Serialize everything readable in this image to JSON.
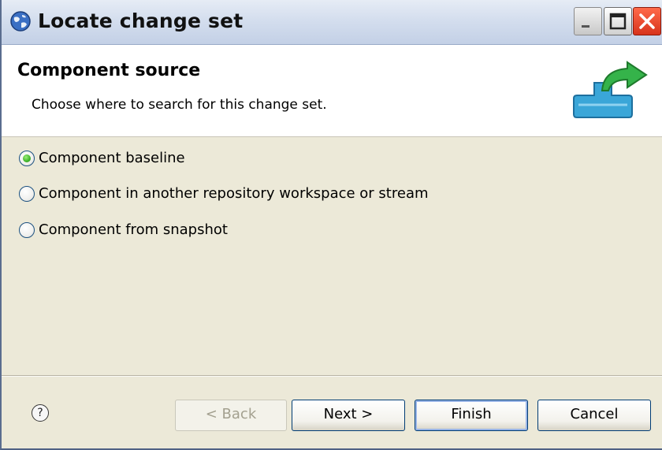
{
  "window": {
    "title": "Locate change set",
    "app_icon": "globe-icon",
    "controls": [
      {
        "name": "minimize-button",
        "icon": "minimize-icon"
      },
      {
        "name": "maximize-button",
        "icon": "maximize-icon"
      },
      {
        "name": "close-button",
        "icon": "close-icon"
      }
    ]
  },
  "header": {
    "title": "Component source",
    "description": "Choose where to search for this change set.",
    "graphic": "component-arrow-icon"
  },
  "options": [
    {
      "label": "Component baseline",
      "checked": true,
      "mnemonic": "C"
    },
    {
      "label": "Component in another repository workspace or stream",
      "checked": false,
      "mnemonic": "w"
    },
    {
      "label": "Component from snapshot",
      "checked": false,
      "mnemonic": "s"
    }
  ],
  "footer": {
    "help_glyph": "?",
    "buttons": {
      "back": "< Back",
      "next": "Next >",
      "finish": "Finish",
      "cancel": "Cancel"
    }
  },
  "colors": {
    "title_text": "#111111",
    "radio_checked": "#3fb32a",
    "close_button": "#d7331c",
    "button_border": "#003c74"
  }
}
